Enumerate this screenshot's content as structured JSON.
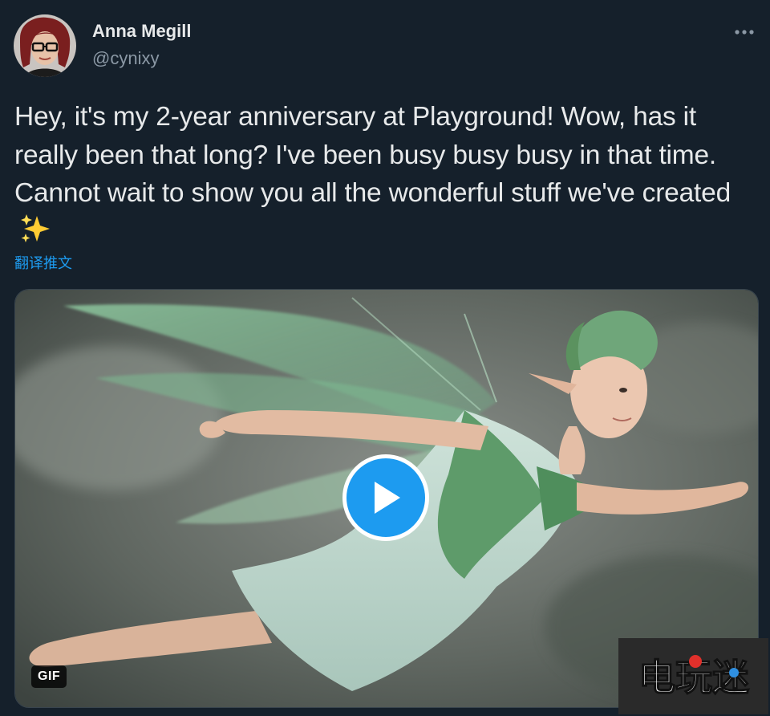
{
  "author": {
    "name": "Anna Megill",
    "handle": "@cynixy",
    "avatar_icon": "avatar-photo"
  },
  "tweet": {
    "text": "Hey, it's my 2-year anniversary at Playground! Wow, has it really been that long? I've been busy busy busy in that time. Cannot wait to show you all the wonderful stuff we've created",
    "emoji_icon": "sparkles-icon",
    "translate_label": "翻译推文"
  },
  "media": {
    "type_badge": "GIF",
    "play_icon": "play-icon"
  },
  "menu": {
    "more_icon": "more-horizontal-icon"
  },
  "watermark": {
    "text": "电玩迷"
  },
  "colors": {
    "background": "#15202b",
    "accent": "#1d9bf0",
    "text_primary": "#e7e9ea",
    "text_secondary": "#8b98a5"
  }
}
